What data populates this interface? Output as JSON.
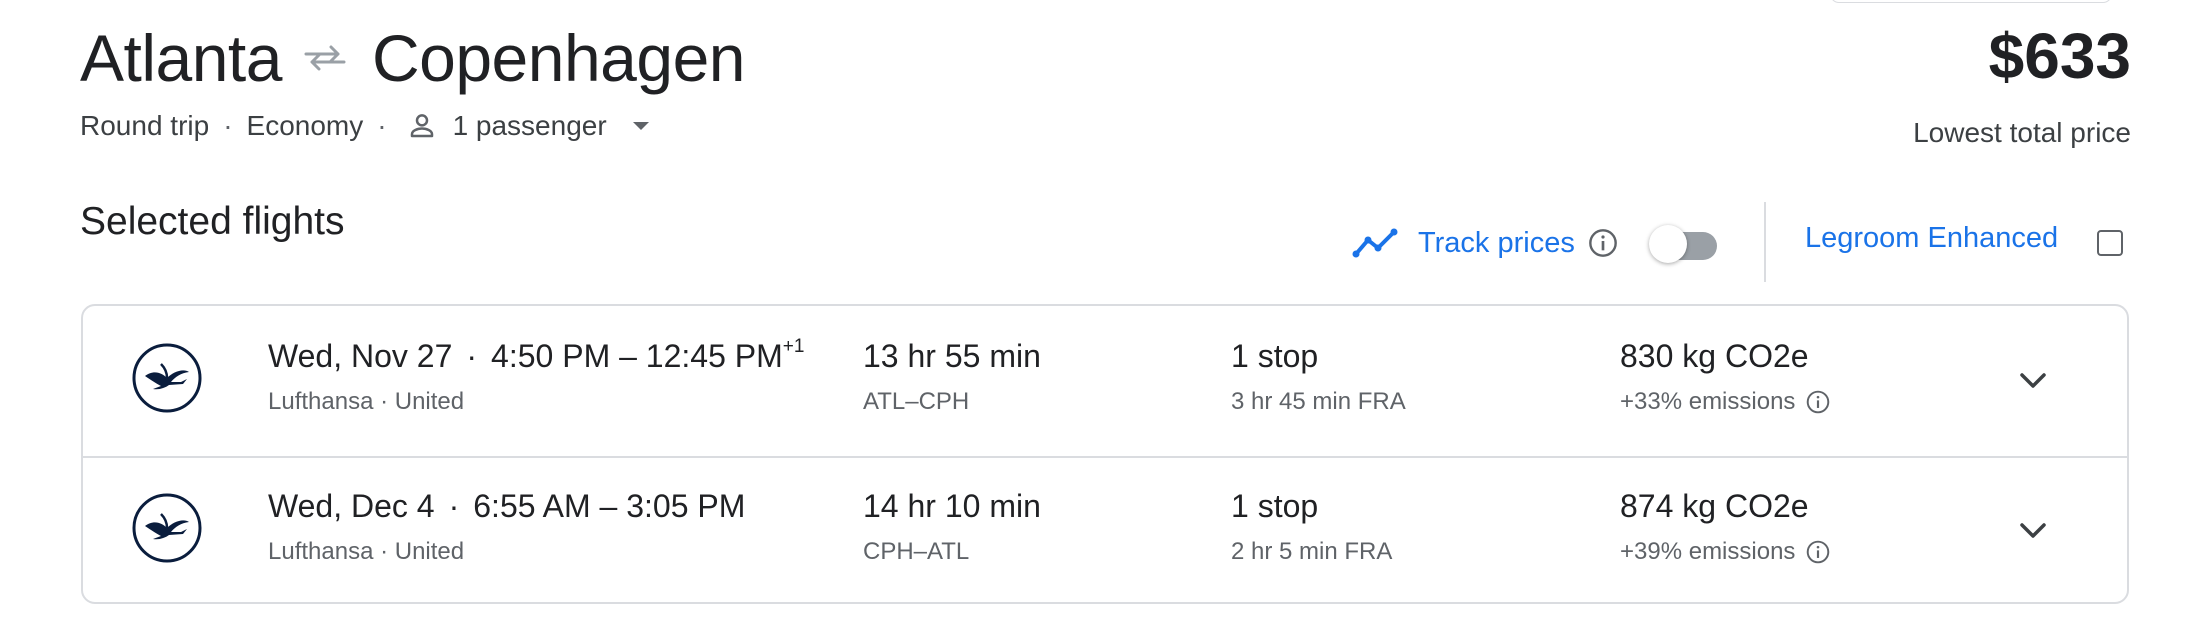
{
  "header": {
    "origin": "Atlanta",
    "destination": "Copenhagen",
    "trip_type": "Round trip",
    "cabin": "Economy",
    "passengers": "1 passenger",
    "price": "$633",
    "price_label": "Lowest total price"
  },
  "selected": {
    "title": "Selected flights",
    "track_prices_label": "Track prices",
    "track_prices_enabled": false,
    "legroom_label": "Legroom Enhanced",
    "legroom_checked": false
  },
  "flights": [
    {
      "date": "Wed, Nov 27",
      "times": "4:50 PM – 12:45 PM",
      "day_offset": "+1",
      "airlines": "Lufthansa · United",
      "duration": "13 hr 55 min",
      "route": "ATL–CPH",
      "stops": "1 stop",
      "stop_detail": "3 hr 45 min FRA",
      "co2": "830 kg CO2e",
      "emissions": "+33% emissions"
    },
    {
      "date": "Wed, Dec 4",
      "times": "6:55 AM – 3:05 PM",
      "day_offset": "",
      "airlines": "Lufthansa · United",
      "duration": "14 hr 10 min",
      "route": "CPH–ATL",
      "stops": "1 stop",
      "stop_detail": "2 hr 5 min FRA",
      "co2": "874 kg CO2e",
      "emissions": "+39% emissions"
    }
  ],
  "icons": {
    "swap": "swap-arrows-icon",
    "person": "person-icon",
    "caret": "caret-down-icon",
    "trend": "trending-line-icon",
    "info": "info-icon",
    "airline": "lufthansa-crane-logo",
    "expand": "chevron-down-icon"
  },
  "colors": {
    "accent": "#1a73e8",
    "text": "#202124",
    "secondary": "#5f6368",
    "border": "#dadce0",
    "logo": "#0a1d3d"
  }
}
